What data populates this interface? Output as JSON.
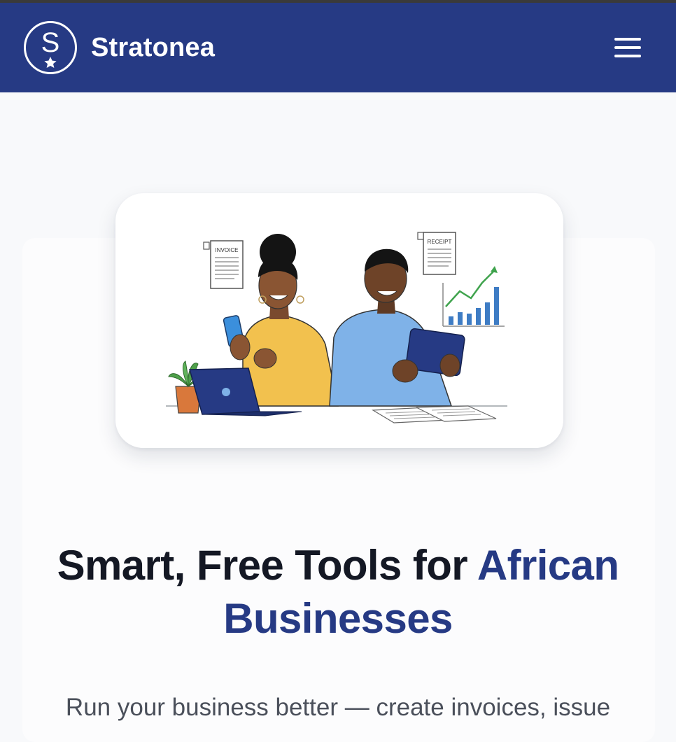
{
  "nav": {
    "logo_letter": "S",
    "brand_name": "Stratonea",
    "menu_icon": "hamburger-menu-icon"
  },
  "hero": {
    "image": {
      "invoice_label": "INVOICE",
      "receipt_label": "RECEIPT"
    },
    "headline_part1": "Smart, Free Tools for ",
    "headline_accent": "African Businesses",
    "subtext": "Run your business better — create invoices, issue"
  },
  "colors": {
    "nav_bg": "#263a84",
    "accent": "#263a84",
    "page_bg": "#f8f9fb",
    "headline": "#141824",
    "subtext": "#4a4f5a"
  }
}
